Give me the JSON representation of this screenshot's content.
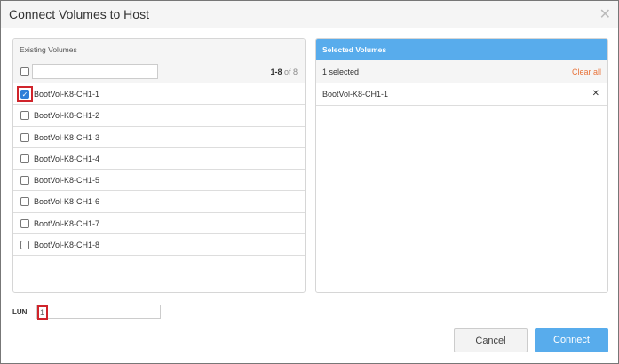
{
  "dialog": {
    "title": "Connect Volumes to Host"
  },
  "existing": {
    "header": "Existing Volumes",
    "range": "1-8",
    "of": "of 8",
    "search_value": "",
    "items": [
      {
        "label": "BootVol-K8-CH1-1",
        "checked": true
      },
      {
        "label": "BootVol-K8-CH1-2",
        "checked": false
      },
      {
        "label": "BootVol-K8-CH1-3",
        "checked": false
      },
      {
        "label": "BootVol-K8-CH1-4",
        "checked": false
      },
      {
        "label": "BootVol-K8-CH1-5",
        "checked": false
      },
      {
        "label": "BootVol-K8-CH1-6",
        "checked": false
      },
      {
        "label": "BootVol-K8-CH1-7",
        "checked": false
      },
      {
        "label": "BootVol-K8-CH1-8",
        "checked": false
      }
    ]
  },
  "selected": {
    "header": "Selected Volumes",
    "count_text": "1 selected",
    "clear_label": "Clear all",
    "items": [
      {
        "label": "BootVol-K8-CH1-1"
      }
    ]
  },
  "lun": {
    "label": "LUN",
    "value": "1"
  },
  "buttons": {
    "cancel": "Cancel",
    "connect": "Connect"
  },
  "colors": {
    "accent": "#58acec",
    "highlight": "#d0242b",
    "link": "#e8733a"
  }
}
